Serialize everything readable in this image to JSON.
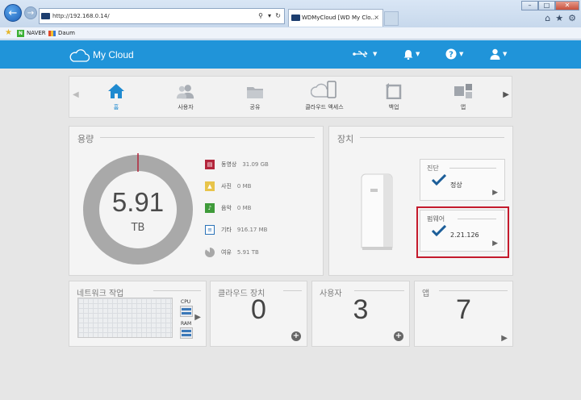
{
  "browser": {
    "url": "http://192.168.0.14/",
    "tab_title": "WDMyCloud [WD My Clo...",
    "favorites": [
      "NAVER",
      "Daum"
    ]
  },
  "brand": "My Cloud",
  "nav": {
    "items": [
      {
        "label": "홈",
        "icon": "home-icon"
      },
      {
        "label": "사용자",
        "icon": "users-icon"
      },
      {
        "label": "공유",
        "icon": "folder-icon"
      },
      {
        "label": "클라우드 액세스",
        "icon": "cloud-device-icon"
      },
      {
        "label": "백업",
        "icon": "backup-icon"
      },
      {
        "label": "앱",
        "icon": "apps-icon"
      }
    ]
  },
  "capacity": {
    "title": "용량",
    "value": "5.91",
    "unit": "TB",
    "legend": [
      {
        "label": "동영상",
        "value": "31.09 GB",
        "color": "#b3253b"
      },
      {
        "label": "사진",
        "value": "0 MB",
        "color": "#e8c44a"
      },
      {
        "label": "음악",
        "value": "0 MB",
        "color": "#3f9b3a"
      },
      {
        "label": "기타",
        "value": "916.17 MB",
        "color": "#2a72b8"
      },
      {
        "label": "여유",
        "value": "5.91 TB",
        "color": "#a8a8a8"
      }
    ]
  },
  "device": {
    "title": "장치",
    "diagnostics": {
      "title": "진단",
      "value": "정상"
    },
    "firmware": {
      "title": "펌웨어",
      "value": "2.21.126"
    }
  },
  "network": {
    "title": "네트워크 작업",
    "cpu_label": "CPU",
    "ram_label": "RAM"
  },
  "cloud_devices": {
    "title": "클라우드 장치",
    "count": "0"
  },
  "users": {
    "title": "사용자",
    "count": "3"
  },
  "apps": {
    "title": "앱",
    "count": "7"
  },
  "colors": {
    "accent": "#2094d9",
    "highlight": "#c41a2c"
  }
}
